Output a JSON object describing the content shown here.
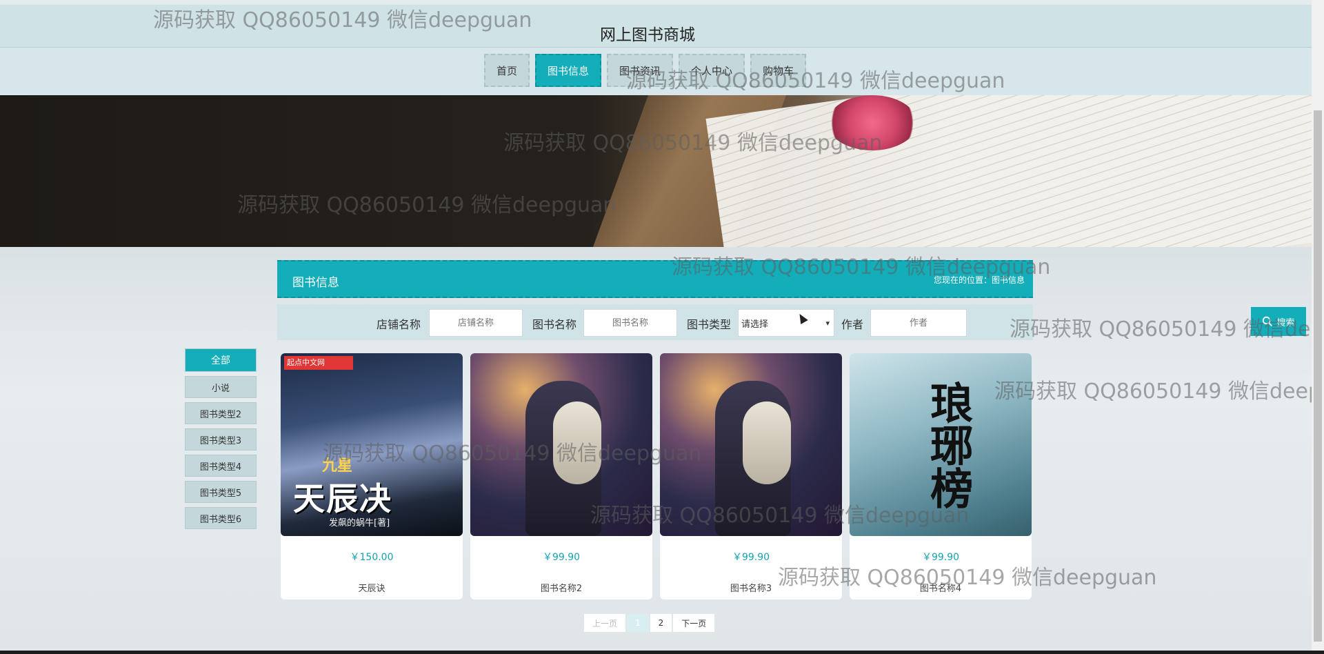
{
  "site": {
    "title": "网上图书商城"
  },
  "nav": {
    "items": [
      {
        "label": "首页"
      },
      {
        "label": "图书信息"
      },
      {
        "label": "图书资讯"
      },
      {
        "label": "个人中心"
      },
      {
        "label": "购物车"
      }
    ],
    "active_index": 1
  },
  "section": {
    "title": "图书信息",
    "breadcrumb": "您现在的位置：图书信息"
  },
  "search": {
    "shop_label": "店铺名称",
    "shop_placeholder": "店铺名称",
    "book_label": "图书名称",
    "book_placeholder": "图书名称",
    "type_label": "图书类型",
    "type_selected": "请选择",
    "author_label": "作者",
    "author_placeholder": "作者",
    "button_label": "搜索"
  },
  "categories": [
    {
      "label": "全部"
    },
    {
      "label": "小说"
    },
    {
      "label": "图书类型2"
    },
    {
      "label": "图书类型3"
    },
    {
      "label": "图书类型4"
    },
    {
      "label": "图书类型5"
    },
    {
      "label": "图书类型6"
    }
  ],
  "books": [
    {
      "price": "￥150.00",
      "name": "天辰诀",
      "cover_text": "天辰决",
      "cover_badge": "起点中文网",
      "cover_sub": "九星",
      "cover_author": "发飙的蜗牛[著]"
    },
    {
      "price": "￥99.90",
      "name": "图书名称2"
    },
    {
      "price": "￥99.90",
      "name": "图书名称3"
    },
    {
      "price": "￥99.90",
      "name": "图书名称4",
      "cover_text": "琅琊榜"
    }
  ],
  "pagination": {
    "prev": "上一页",
    "pages": [
      "1",
      "2"
    ],
    "current": "1",
    "next": "下一页"
  },
  "watermark": "源码获取 QQ86050149 微信deepguan",
  "colors": {
    "accent": "#14adba",
    "nav_bg": "#d6e6eb",
    "header_bg": "#cfe2e6"
  }
}
